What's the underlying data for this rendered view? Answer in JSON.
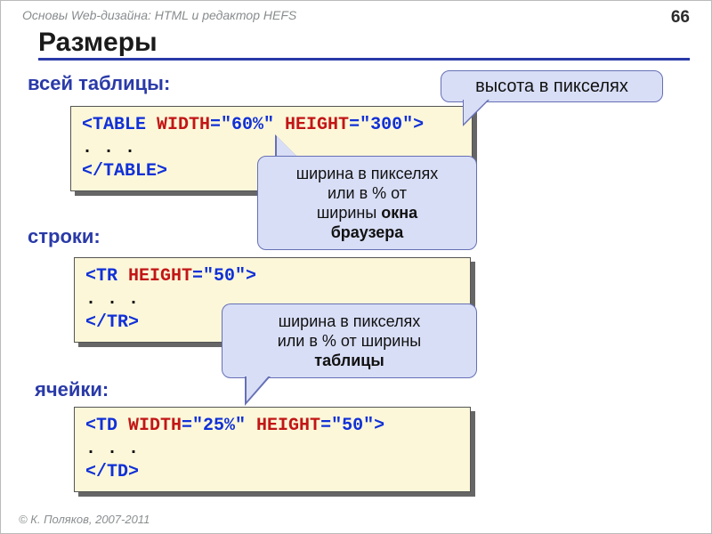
{
  "header": {
    "left": "Основы Web-дизайна: HTML и редактор HEFS",
    "page": "66"
  },
  "title": "Размеры",
  "sub1": "всей таблицы:",
  "sub2": "строки:",
  "sub3": "ячейки:",
  "box1": {
    "a": "<TABLE ",
    "w": "WIDTH",
    "eq1": "=\"60%\" ",
    "h": "HEIGHT",
    "eq2": "=\"300\">",
    "dots": ". . .",
    "close": "</TABLE>"
  },
  "box2": {
    "a": "<TR ",
    "h": "HEIGHT",
    "eq": "=\"50\">",
    "dots": ". . .",
    "close": "</TR>"
  },
  "box3": {
    "a": "<TD ",
    "w": "WIDTH",
    "eq1": "=\"25%\" ",
    "h": "HEIGHT",
    "eq2": "=\"50\">",
    "dots": ". . .",
    "close": "</TD>"
  },
  "call1": "высота в пикселях",
  "call2_l1": "ширина в пикселях",
  "call2_l2": "или в % от",
  "call2_l3a": "ширины ",
  "call2_l3b": "окна",
  "call2_l4": "браузера",
  "call3_l1": "ширина в пикселях",
  "call3_l2": "или в % от ширины",
  "call3_l3": "таблицы",
  "footer": "© К. Поляков, 2007-2011"
}
